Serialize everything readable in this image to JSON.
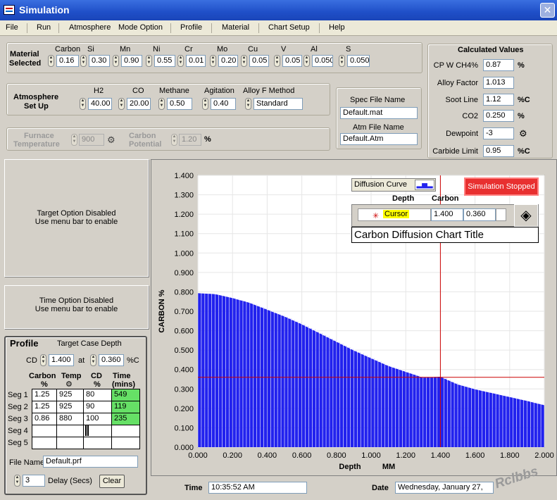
{
  "window": {
    "title": "Simulation",
    "close": "✕"
  },
  "menu": [
    "File",
    "Run",
    "Atmosphere",
    "Mode Option",
    "Profile",
    "Material",
    "Chart Setup",
    "Help"
  ],
  "material": {
    "label1": "Material",
    "label2": "Selected",
    "elements": [
      {
        "name": "Carbon",
        "value": "0.16"
      },
      {
        "name": "Si",
        "value": "0.30"
      },
      {
        "name": "Mn",
        "value": "0.90"
      },
      {
        "name": "Ni",
        "value": "0.55"
      },
      {
        "name": "Cr",
        "value": "0.01"
      },
      {
        "name": "Mo",
        "value": "0.20"
      },
      {
        "name": "Cu",
        "value": "0.05"
      },
      {
        "name": "V",
        "value": "0.05"
      },
      {
        "name": "Al",
        "value": "0.050"
      },
      {
        "name": "S",
        "value": "0.050"
      }
    ]
  },
  "atmosphere": {
    "label1": "Atmosphere",
    "label2": "Set Up",
    "h2_label": "H2",
    "h2": "40.00",
    "co_label": "CO",
    "co": "20.00",
    "methane_label": "Methane",
    "methane": "0.50",
    "agitation_label": "Agitation",
    "agitation": "0.40",
    "alloy_label": "Alloy F Method",
    "alloy": "Standard"
  },
  "files": {
    "spec_label": "Spec File Name",
    "spec": "Default.mat",
    "atm_label": "Atm File Name",
    "atm": "Default.Atm"
  },
  "furnace": {
    "label1": "Furnace",
    "label2": "Temperature",
    "value": "900",
    "carbon_label1": "Carbon",
    "carbon_label2": "Potential",
    "carbon_value": "1.20",
    "carbon_unit": "%"
  },
  "calculated": {
    "title": "Calculated Values",
    "rows": [
      {
        "label": "CP W CH4%",
        "value": "0.87",
        "unit": "%"
      },
      {
        "label": "Alloy Factor",
        "value": "1.013",
        "unit": ""
      },
      {
        "label": "Soot Line",
        "value": "1.12",
        "unit": "%C"
      },
      {
        "label": "CO2",
        "value": "0.250",
        "unit": "%"
      },
      {
        "label": "Dewpoint",
        "value": "-3",
        "unit": ""
      },
      {
        "label": "Carbide Limit",
        "value": "0.95",
        "unit": "%C"
      }
    ]
  },
  "target_option": {
    "line1": "Target Option Disabled",
    "line2": "Use menu bar to enable"
  },
  "time_option": {
    "line1": "Time Option Disabled",
    "line2": "Use menu bar to enable"
  },
  "profile": {
    "title": "Profile",
    "target_label": "Target Case Depth",
    "cd_label": "CD",
    "cd": "1.400",
    "at_label": "at",
    "at_value": "0.360",
    "at_unit": "%C",
    "headers": {
      "carbon1": "Carbon",
      "carbon2": "%",
      "temp": "Temp",
      "cd1": "CD",
      "cd2": "%",
      "time1": "Time",
      "time2": "(mins)"
    },
    "segments": [
      {
        "label": "Seg 1",
        "carbon": "1.25",
        "temp": "925",
        "cd": "80",
        "time": "549"
      },
      {
        "label": "Seg 2",
        "carbon": "1.25",
        "temp": "925",
        "cd": "90",
        "time": "119"
      },
      {
        "label": "Seg 3",
        "carbon": "0.86",
        "temp": "880",
        "cd": "100",
        "time": "235"
      },
      {
        "label": "Seg 4",
        "carbon": "",
        "temp": "",
        "cd": "",
        "time": ""
      },
      {
        "label": "Seg 5",
        "carbon": "",
        "temp": "",
        "cd": "",
        "time": ""
      }
    ],
    "file_label": "File Name",
    "file": "Default.prf",
    "delay": "3",
    "delay_label": "Delay (Secs)",
    "clear": "Clear"
  },
  "status": {
    "time_label": "Time",
    "time": "10:35:52 AM",
    "date_label": "Date",
    "date": "Wednesday, January 27,"
  },
  "chart_controls": {
    "diffusion": "Diffusion Curve",
    "stopped": "Simulation Stopped",
    "depth_header": "Depth",
    "carbon_header": "Carbon",
    "cursor_label": "Cursor",
    "cursor_depth": "1.400",
    "cursor_carbon": "0.360",
    "chart_title": "Carbon Diffusion Chart Title"
  },
  "watermark": "Rclbbs",
  "colors": {
    "bars": "#2222ee",
    "cursor": "#cc0000",
    "stopped": "#e83030",
    "seg_time": "#66e066"
  },
  "chart_data": {
    "type": "bar",
    "xlabel": "Depth",
    "xunit": "MM",
    "ylabel": "CARBON %",
    "xlim": [
      0,
      2.0
    ],
    "ylim": [
      0,
      1.4
    ],
    "xticks": [
      "0.000",
      "0.200",
      "0.400",
      "0.600",
      "0.800",
      "1.000",
      "1.200",
      "1.400",
      "1.600",
      "1.800",
      "2.000"
    ],
    "yticks": [
      "0.000",
      "0.100",
      "0.200",
      "0.300",
      "0.400",
      "0.500",
      "0.600",
      "0.700",
      "0.800",
      "0.900",
      "1.000",
      "1.100",
      "1.200",
      "1.300",
      "1.400"
    ],
    "grid": true,
    "cursor": {
      "x": 1.4,
      "y": 0.36
    },
    "profile_points": [
      [
        0,
        0.795
      ],
      [
        0.1,
        0.79
      ],
      [
        0.2,
        0.77
      ],
      [
        0.3,
        0.745
      ],
      [
        0.4,
        0.71
      ],
      [
        0.5,
        0.675
      ],
      [
        0.6,
        0.635
      ],
      [
        0.7,
        0.59
      ],
      [
        0.8,
        0.545
      ],
      [
        0.9,
        0.5
      ],
      [
        1.0,
        0.46
      ],
      [
        1.1,
        0.42
      ],
      [
        1.2,
        0.39
      ],
      [
        1.3,
        0.36
      ],
      [
        1.4,
        0.365
      ],
      [
        1.5,
        0.325
      ],
      [
        1.6,
        0.3
      ],
      [
        1.7,
        0.28
      ],
      [
        1.8,
        0.26
      ],
      [
        1.9,
        0.24
      ],
      [
        2.0,
        0.218
      ]
    ]
  }
}
